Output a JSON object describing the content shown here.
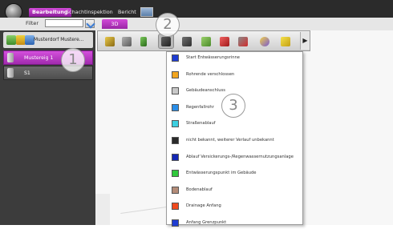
{
  "menu": {
    "tabs": [
      {
        "label": "Bearbeitung",
        "active": true
      },
      {
        "label": "Schachtinspektion",
        "active": false
      },
      {
        "label": "Bericht",
        "active": false
      }
    ]
  },
  "filter": {
    "label": "Filter",
    "value": ""
  },
  "view_tab": "3D",
  "left_toolbar": {
    "label": "Musterdorf Mustere..."
  },
  "tree": {
    "items": [
      {
        "label": "Mustereig 1",
        "selected": true
      },
      {
        "label": "S1",
        "selected": false
      }
    ]
  },
  "toolbar": {
    "buttons": [
      "pipe-tool",
      "node-tool",
      "bottle-tool",
      "connector-tool",
      "branch-tool",
      "pencil-tool",
      "red-pencil-tool",
      "cut-tool",
      "magnifier-tool",
      "marker-tool"
    ],
    "active": "connector-tool"
  },
  "dropdown": {
    "items": [
      {
        "label": "Start Entwässerungsrinne",
        "color": "#1e3cd2"
      },
      {
        "label": "Rohrende verschlossen",
        "color": "#f2a51e"
      },
      {
        "label": "Gebäudeanschluss",
        "color": "#c8c8c8"
      },
      {
        "label": "Regenfallrohr",
        "color": "#2a8ee8"
      },
      {
        "label": "Straßenablauf",
        "color": "#3ccfe0"
      },
      {
        "label": "nicht bekannt, weiterer Verlauf unbekannt",
        "color": "#2a2a2a"
      },
      {
        "label": "Ablauf Versickerungs-/Regenwassernutzungsanlage",
        "color": "#1428b4"
      },
      {
        "label": "Entwässerungspunkt im Gebäude",
        "color": "#30c83c"
      },
      {
        "label": "Bodenablauf",
        "color": "#b48c78"
      },
      {
        "label": "Drainage Anfang",
        "color": "#f04a1e"
      },
      {
        "label": "Anfang Grenzpunkt",
        "color": "#1e3cd2"
      }
    ]
  },
  "callouts": [
    "1",
    "2",
    "3"
  ],
  "colors": {
    "accent": "#b432c0",
    "titlebar": "#2b2b2b"
  }
}
